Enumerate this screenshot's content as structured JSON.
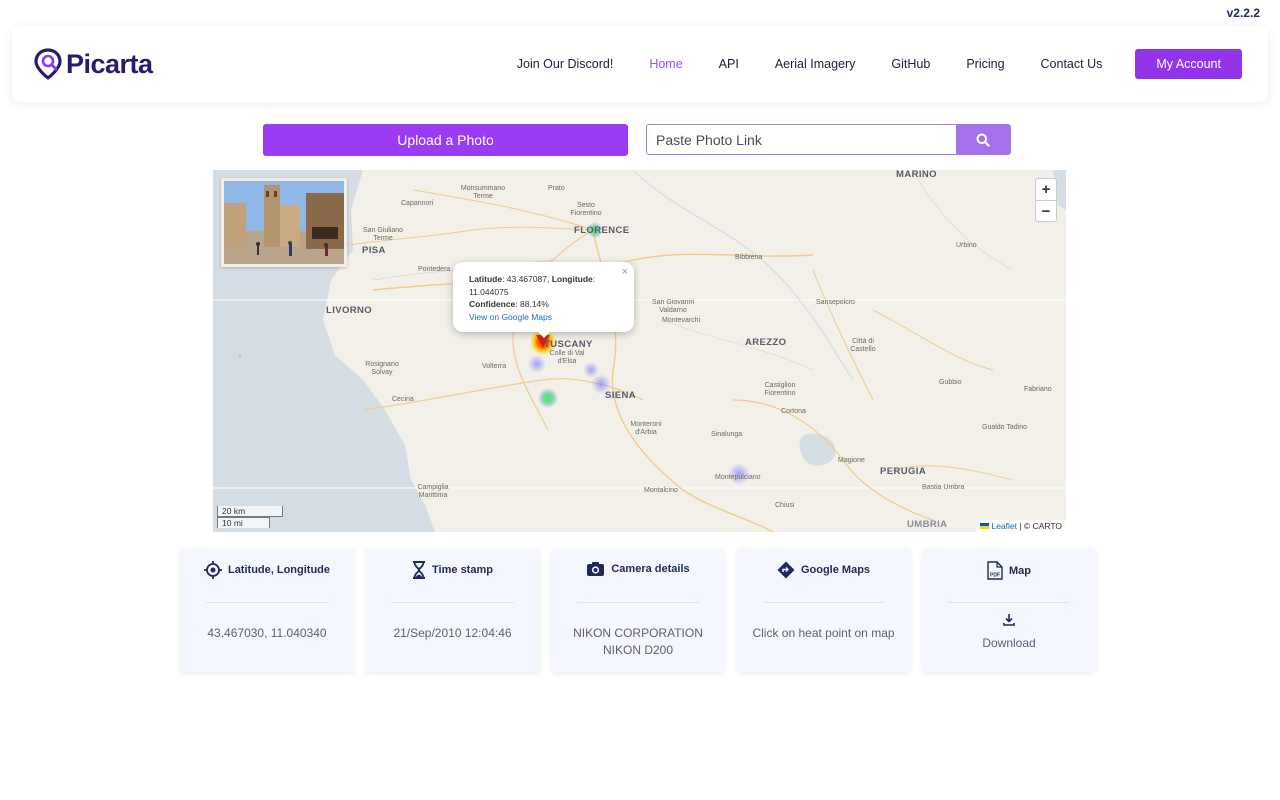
{
  "version": "v2.2.2",
  "brand": {
    "name": "Picarta",
    "color": "#2a1a6e"
  },
  "nav": {
    "discord": "Join Our Discord!",
    "home": "Home",
    "api": "API",
    "aerial": "Aerial Imagery",
    "github": "GitHub",
    "pricing": "Pricing",
    "contact": "Contact Us",
    "account": "My Account"
  },
  "upload": {
    "label": "Upload a Photo"
  },
  "photo_link": {
    "placeholder": "Paste Photo Link",
    "value": ""
  },
  "colors": {
    "accent": "#9333ea",
    "active_nav": "#9b4dff"
  },
  "map": {
    "labels": [
      {
        "text": "MARINO",
        "kind": "big"
      },
      {
        "text": "Monsummano Terme",
        "kind": "town"
      },
      {
        "text": "Prato",
        "kind": "town"
      },
      {
        "text": "Sesto Fiorentino",
        "kind": "town"
      },
      {
        "text": "FLORENCE",
        "kind": "big"
      },
      {
        "text": "Capannori",
        "kind": "town"
      },
      {
        "text": "San Giuliano Terme",
        "kind": "town"
      },
      {
        "text": "PISA",
        "kind": "big"
      },
      {
        "text": "Pontedera",
        "kind": "town"
      },
      {
        "text": "Bibbiena",
        "kind": "town"
      },
      {
        "text": "Urbino",
        "kind": "town"
      },
      {
        "text": "LIVORNO",
        "kind": "big"
      },
      {
        "text": "San Giovanni Valdarno",
        "kind": "town"
      },
      {
        "text": "Montevarchi",
        "kind": "town"
      },
      {
        "text": "Sansepolcro",
        "kind": "town"
      },
      {
        "text": "TUSCANY",
        "kind": "big"
      },
      {
        "text": "AREZZO",
        "kind": "big"
      },
      {
        "text": "Città di Castello",
        "kind": "town"
      },
      {
        "text": "Colle di Val d'Elsa",
        "kind": "town"
      },
      {
        "text": "Rosignano Solvay",
        "kind": "town"
      },
      {
        "text": "Volterra",
        "kind": "town"
      },
      {
        "text": "SIENA",
        "kind": "big"
      },
      {
        "text": "Castiglion Fiorentino",
        "kind": "town"
      },
      {
        "text": "Gubbio",
        "kind": "town"
      },
      {
        "text": "Fabriano",
        "kind": "town"
      },
      {
        "text": "Cecina",
        "kind": "town"
      },
      {
        "text": "Cortona",
        "kind": "town"
      },
      {
        "text": "Monteroni d'Arbia",
        "kind": "town"
      },
      {
        "text": "Sinalunga",
        "kind": "town"
      },
      {
        "text": "Gualdo Tadino",
        "kind": "town"
      },
      {
        "text": "Magione",
        "kind": "town"
      },
      {
        "text": "PERUGIA",
        "kind": "big"
      },
      {
        "text": "Montepulciano",
        "kind": "town"
      },
      {
        "text": "Campiglia Marittima",
        "kind": "town"
      },
      {
        "text": "Montalcino",
        "kind": "town"
      },
      {
        "text": "Bastia Umbra",
        "kind": "town"
      },
      {
        "text": "Chiusi",
        "kind": "town"
      },
      {
        "text": "UMBRIA",
        "kind": "big"
      }
    ],
    "popup": {
      "lat_label": "Latitude",
      "lat_value": ": 43.467087, ",
      "lon_label": "Longitude",
      "lon_value": ": 11.044075",
      "conf_label": "Confidence",
      "conf_value": ": 88.14%",
      "link": "View on Google Maps",
      "close": "×"
    },
    "zoom_in": "+",
    "zoom_out": "−",
    "scale_km": "20 km",
    "scale_mi": "10 mi",
    "attribution_leaflet": "Leaflet",
    "attribution_rest": " | © CARTO"
  },
  "cards": [
    {
      "title": "Latitude, Longitude",
      "value": "43.467030, 11.040340",
      "icon": "crosshair-icon"
    },
    {
      "title": "Time stamp",
      "value": "21/Sep/2010 12:04:46",
      "icon": "hourglass-icon"
    },
    {
      "title": "Camera details",
      "value_line1": "NIKON CORPORATION",
      "value_line2": "NIKON D200",
      "icon": "camera-icon"
    },
    {
      "title": "Google Maps",
      "value": "Click on heat point on map",
      "icon": "directions-icon"
    },
    {
      "title": "Map",
      "value": "Download",
      "icon": "pdf-icon"
    }
  ]
}
